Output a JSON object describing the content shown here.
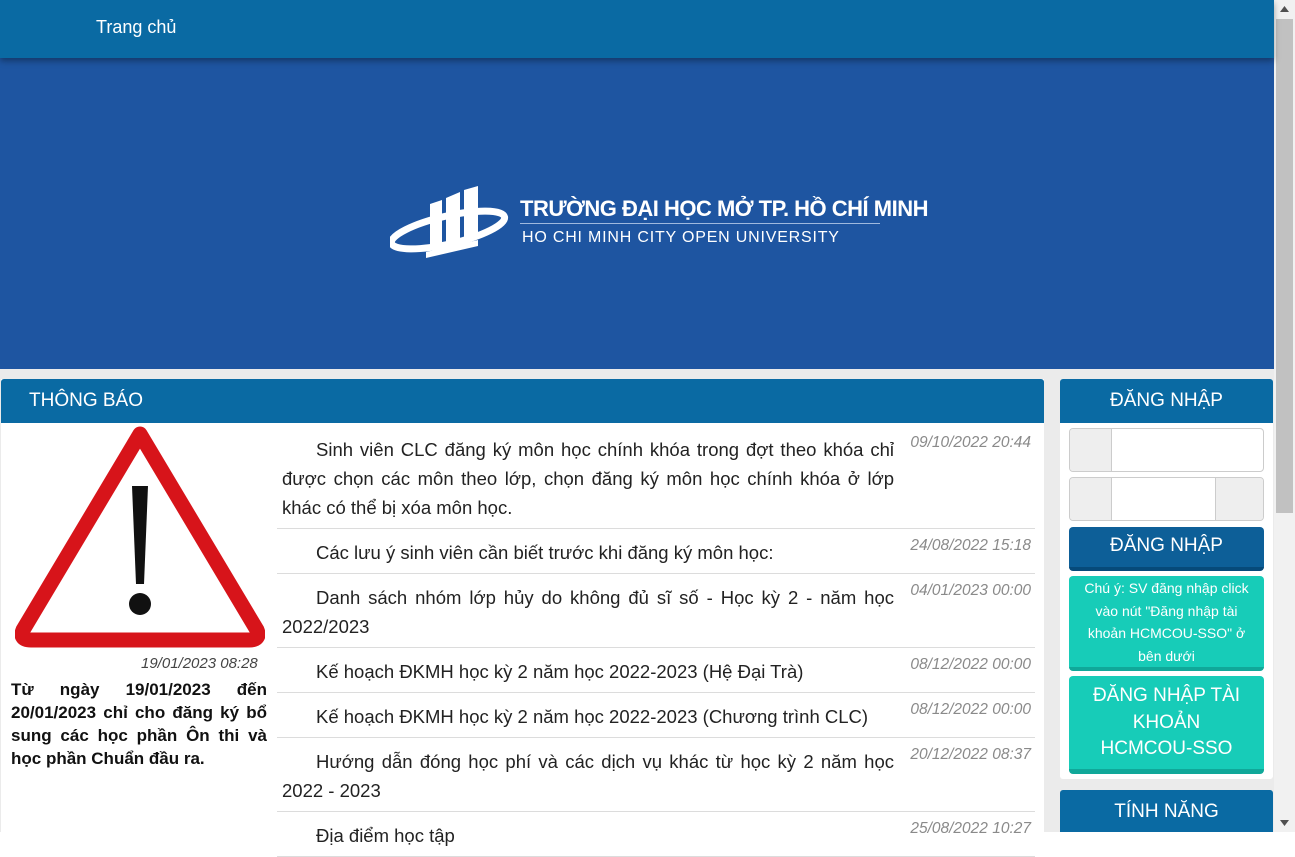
{
  "nav": {
    "home_label": "Trang chủ"
  },
  "banner": {
    "university_vn": "TRƯỜNG ĐẠI HỌC MỞ TP. HỒ CHÍ MINH",
    "university_en": "HO CHI MINH CITY OPEN UNIVERSITY"
  },
  "news": {
    "header": "THÔNG BÁO",
    "featured": {
      "date": "19/01/2023 08:28",
      "text": "Từ ngày 19/01/2023 đến 20/01/2023 chỉ cho đăng ký bổ sung các học phần Ôn thi và học phần Chuẩn đầu ra."
    },
    "items": [
      {
        "title": "Sinh viên CLC đăng ký môn học chính khóa trong đợt theo khóa chỉ được chọn các môn theo lớp, chọn đăng ký môn học chính khóa ở lớp khác có thể bị xóa môn học.",
        "date": "09/10/2022 20:44"
      },
      {
        "title": "Các lưu ý sinh viên cần biết trước khi đăng ký môn học:",
        "date": "24/08/2022 15:18"
      },
      {
        "title": "Danh sách nhóm lớp hủy do không đủ sĩ số - Học kỳ 2 - năm học 2022/2023",
        "date": "04/01/2023 00:00"
      },
      {
        "title": "Kế hoạch ĐKMH học kỳ 2 năm học 2022-2023 (Hệ Đại Trà)",
        "date": "08/12/2022 00:00"
      },
      {
        "title": "Kế hoạch ĐKMH học kỳ 2 năm học 2022-2023 (Chương trình CLC)",
        "date": "08/12/2022 00:00"
      },
      {
        "title": "Hướng dẫn đóng học phí và các dịch vụ khác từ học kỳ 2 năm học 2022 - 2023",
        "date": "20/12/2022 08:37"
      },
      {
        "title": "Địa điểm học tập",
        "date": "25/08/2022 10:27"
      }
    ]
  },
  "login": {
    "header": "ĐĂNG NHẬP",
    "username_value": "",
    "password_value": "",
    "login_button": "ĐĂNG NHẬP",
    "note": "Chú ý: SV đăng nhập click vào nút \"Đăng nhập tài khoản HCMCOU-SSO\" ở bên dưới",
    "sso_button": "ĐĂNG NHẬP TÀI KHOẢN HCMCOU-SSO"
  },
  "features": {
    "header": "TÍNH NĂNG"
  },
  "colors": {
    "primary": "#0a6aa3",
    "banner": "#1e55a1",
    "teal": "#17ccb8",
    "warning_red": "#d7141a"
  },
  "icons": [
    "university-logo-icon",
    "warning-icon",
    "user-icon",
    "lock-icon"
  ]
}
